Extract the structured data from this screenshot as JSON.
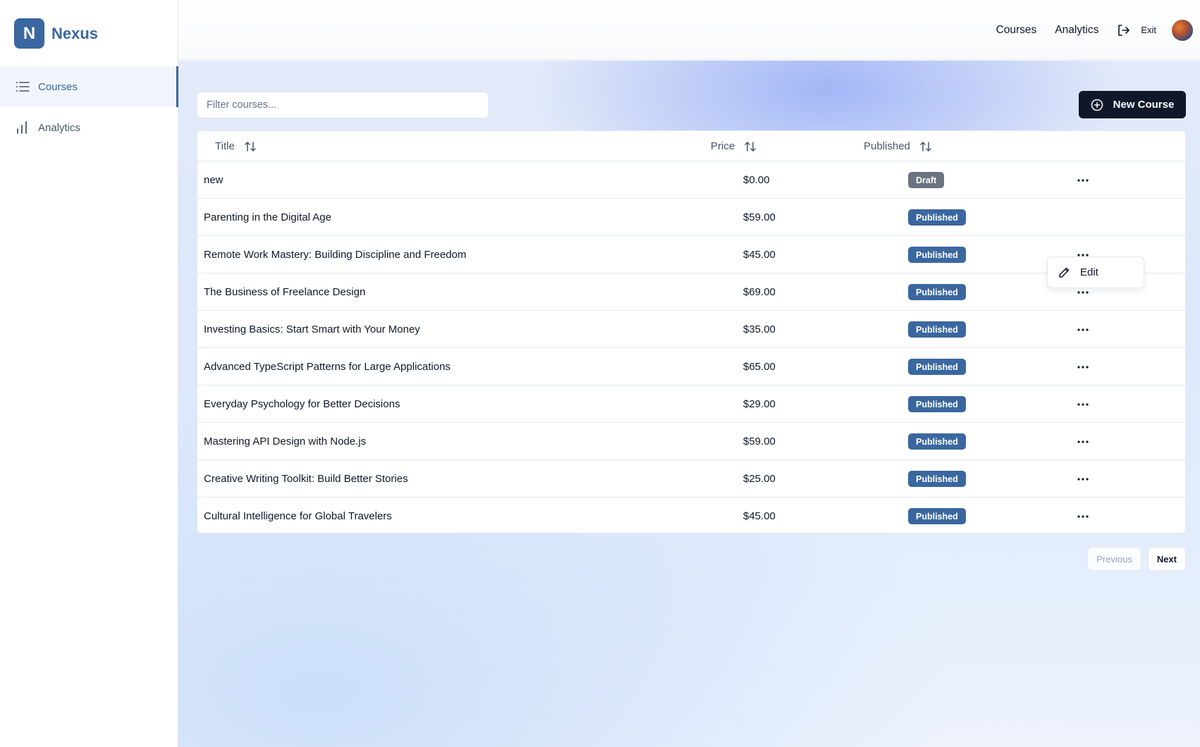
{
  "app": {
    "logo_letter": "N",
    "name": "Nexus"
  },
  "sidebar": {
    "items": [
      {
        "label": "Courses",
        "icon": "list-icon",
        "active": true
      },
      {
        "label": "Analytics",
        "icon": "bar-chart-icon",
        "active": false
      }
    ]
  },
  "header": {
    "links": [
      "Courses",
      "Analytics"
    ],
    "exit_label": "Exit"
  },
  "filter": {
    "placeholder": "Filter courses...",
    "value": ""
  },
  "new_course_label": "New Course",
  "table": {
    "columns": [
      "Title",
      "Price",
      "Published"
    ],
    "rows": [
      {
        "title": "new",
        "price": "$0.00",
        "status": "Draft"
      },
      {
        "title": "Parenting in the Digital Age",
        "price": "$59.00",
        "status": "Published"
      },
      {
        "title": "Remote Work Mastery: Building Discipline and Freedom",
        "price": "$45.00",
        "status": "Published"
      },
      {
        "title": "The Business of Freelance Design",
        "price": "$69.00",
        "status": "Published"
      },
      {
        "title": "Investing Basics: Start Smart with Your Money",
        "price": "$35.00",
        "status": "Published"
      },
      {
        "title": "Advanced TypeScript Patterns for Large Applications",
        "price": "$65.00",
        "status": "Published"
      },
      {
        "title": "Everyday Psychology for Better Decisions",
        "price": "$29.00",
        "status": "Published"
      },
      {
        "title": "Mastering API Design with Node.js",
        "price": "$59.00",
        "status": "Published"
      },
      {
        "title": "Creative Writing Toolkit: Build Better Stories",
        "price": "$25.00",
        "status": "Published"
      },
      {
        "title": "Cultural Intelligence for Global Travelers",
        "price": "$45.00",
        "status": "Published"
      }
    ]
  },
  "row_menu": {
    "edit_label": "Edit"
  },
  "pagination": {
    "previous_label": "Previous",
    "next_label": "Next"
  },
  "colors": {
    "brand": "#3a679f",
    "primary_button": "#0f1729",
    "draft_badge": "#6b7280"
  }
}
